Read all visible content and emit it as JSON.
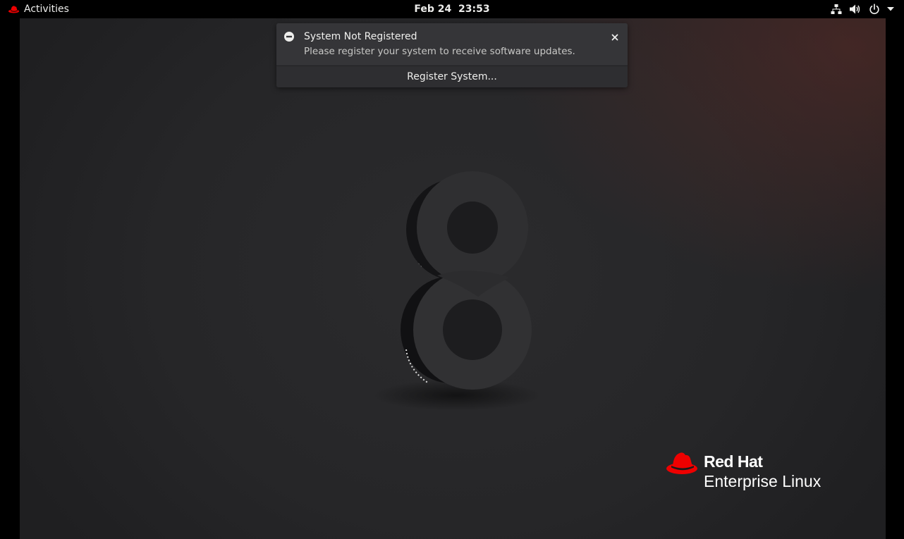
{
  "topbar": {
    "activities_label": "Activities",
    "clock_date": "Feb 24",
    "clock_time": "23:53",
    "tray_icons": [
      "network-wired-icon",
      "volume-icon",
      "power-icon",
      "menu-arrow-icon"
    ]
  },
  "notification": {
    "icon": "minus-circle-icon",
    "title": "System Not Registered",
    "body": "Please register your system to receive software updates.",
    "action_label": "Register System..."
  },
  "desktop": {
    "emblem": "rhel-8-logo",
    "brand_line1": "Red Hat",
    "brand_line2": "Enterprise Linux"
  },
  "colors": {
    "topbar_bg": "#000000",
    "notification_bg": "#353538",
    "brand_red": "#ee0000",
    "desktop_bg": "#262628"
  }
}
